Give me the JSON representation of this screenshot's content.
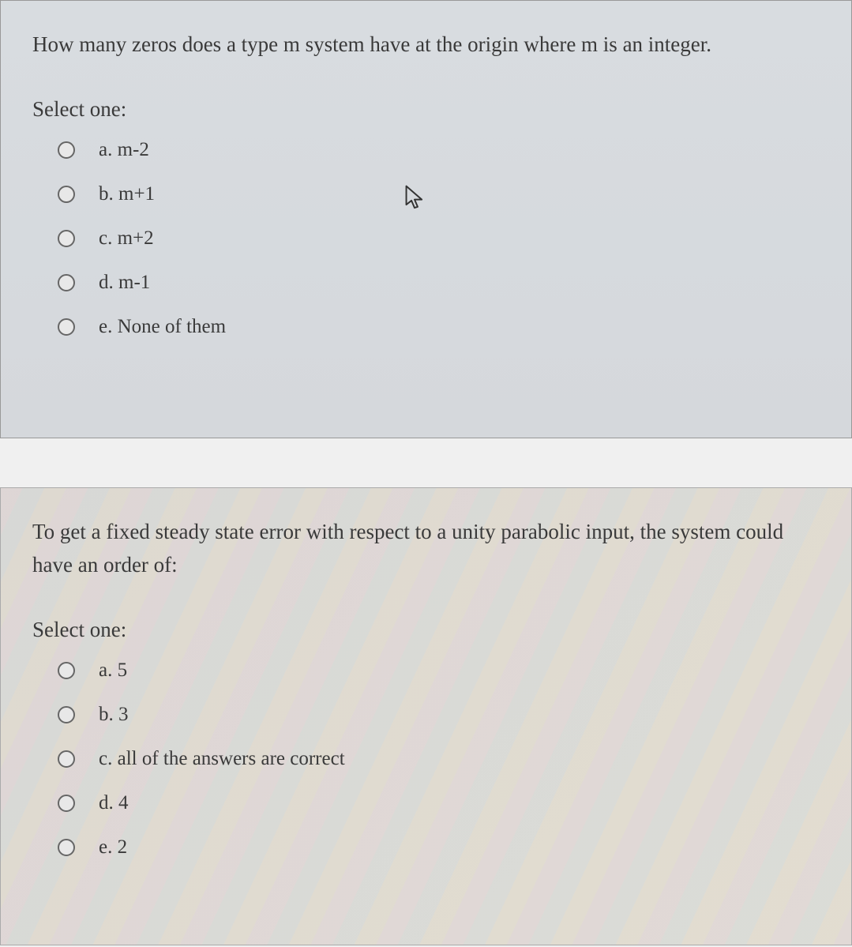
{
  "q1": {
    "question": "How many zeros does a type m system have at the origin where m is an integer.",
    "prompt": "Select one:",
    "options": [
      {
        "label": "a. m-2"
      },
      {
        "label": "b. m+1"
      },
      {
        "label": "c. m+2"
      },
      {
        "label": "d. m-1"
      },
      {
        "label": "e. None of them"
      }
    ]
  },
  "q2": {
    "question": "To get a fixed steady state error with respect to a unity parabolic input, the system could have an order of:",
    "prompt": "Select one:",
    "options": [
      {
        "label": "a. 5"
      },
      {
        "label": "b. 3"
      },
      {
        "label": "c. all of the answers are correct"
      },
      {
        "label": "d. 4"
      },
      {
        "label": "e. 2"
      }
    ]
  }
}
